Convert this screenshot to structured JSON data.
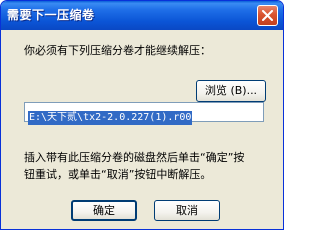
{
  "window": {
    "title": "需要下一压缩卷"
  },
  "dialog": {
    "prompt": "你必须有下列压缩分卷才能继续解压：",
    "browse_label": "浏览",
    "browse_hotkey": "(B)...",
    "path_value": "E:\\天下贰\\tx2-2.0.227(1).r00",
    "instruction_line1": "插入带有此压缩分卷的磁盘然后单击“确定”按",
    "instruction_line2": "钮重试，或单击“取消”按钮中断解压。",
    "ok_label": "确定",
    "cancel_label": "取消"
  },
  "icons": {
    "close": "close-icon"
  },
  "colors": {
    "title_bar": "#0b55d6",
    "close_button": "#d9532f",
    "dialog_background": "#ece9d8",
    "selection": "#316ac5"
  }
}
